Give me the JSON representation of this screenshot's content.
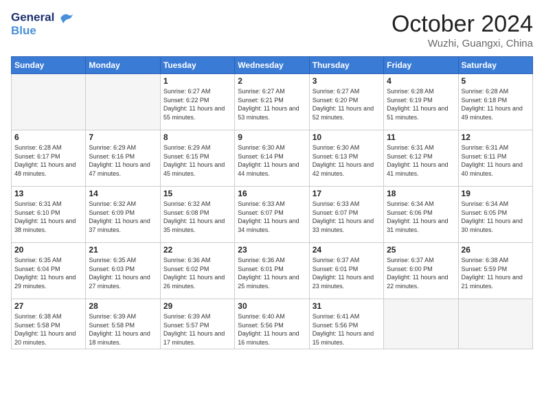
{
  "header": {
    "logo_line1": "General",
    "logo_line2": "Blue",
    "month": "October 2024",
    "location": "Wuzhi, Guangxi, China"
  },
  "weekdays": [
    "Sunday",
    "Monday",
    "Tuesday",
    "Wednesday",
    "Thursday",
    "Friday",
    "Saturday"
  ],
  "weeks": [
    [
      {
        "day": "",
        "info": ""
      },
      {
        "day": "",
        "info": ""
      },
      {
        "day": "1",
        "info": "Sunrise: 6:27 AM\nSunset: 6:22 PM\nDaylight: 11 hours and 55 minutes."
      },
      {
        "day": "2",
        "info": "Sunrise: 6:27 AM\nSunset: 6:21 PM\nDaylight: 11 hours and 53 minutes."
      },
      {
        "day": "3",
        "info": "Sunrise: 6:27 AM\nSunset: 6:20 PM\nDaylight: 11 hours and 52 minutes."
      },
      {
        "day": "4",
        "info": "Sunrise: 6:28 AM\nSunset: 6:19 PM\nDaylight: 11 hours and 51 minutes."
      },
      {
        "day": "5",
        "info": "Sunrise: 6:28 AM\nSunset: 6:18 PM\nDaylight: 11 hours and 49 minutes."
      }
    ],
    [
      {
        "day": "6",
        "info": "Sunrise: 6:28 AM\nSunset: 6:17 PM\nDaylight: 11 hours and 48 minutes."
      },
      {
        "day": "7",
        "info": "Sunrise: 6:29 AM\nSunset: 6:16 PM\nDaylight: 11 hours and 47 minutes."
      },
      {
        "day": "8",
        "info": "Sunrise: 6:29 AM\nSunset: 6:15 PM\nDaylight: 11 hours and 45 minutes."
      },
      {
        "day": "9",
        "info": "Sunrise: 6:30 AM\nSunset: 6:14 PM\nDaylight: 11 hours and 44 minutes."
      },
      {
        "day": "10",
        "info": "Sunrise: 6:30 AM\nSunset: 6:13 PM\nDaylight: 11 hours and 42 minutes."
      },
      {
        "day": "11",
        "info": "Sunrise: 6:31 AM\nSunset: 6:12 PM\nDaylight: 11 hours and 41 minutes."
      },
      {
        "day": "12",
        "info": "Sunrise: 6:31 AM\nSunset: 6:11 PM\nDaylight: 11 hours and 40 minutes."
      }
    ],
    [
      {
        "day": "13",
        "info": "Sunrise: 6:31 AM\nSunset: 6:10 PM\nDaylight: 11 hours and 38 minutes."
      },
      {
        "day": "14",
        "info": "Sunrise: 6:32 AM\nSunset: 6:09 PM\nDaylight: 11 hours and 37 minutes."
      },
      {
        "day": "15",
        "info": "Sunrise: 6:32 AM\nSunset: 6:08 PM\nDaylight: 11 hours and 35 minutes."
      },
      {
        "day": "16",
        "info": "Sunrise: 6:33 AM\nSunset: 6:07 PM\nDaylight: 11 hours and 34 minutes."
      },
      {
        "day": "17",
        "info": "Sunrise: 6:33 AM\nSunset: 6:07 PM\nDaylight: 11 hours and 33 minutes."
      },
      {
        "day": "18",
        "info": "Sunrise: 6:34 AM\nSunset: 6:06 PM\nDaylight: 11 hours and 31 minutes."
      },
      {
        "day": "19",
        "info": "Sunrise: 6:34 AM\nSunset: 6:05 PM\nDaylight: 11 hours and 30 minutes."
      }
    ],
    [
      {
        "day": "20",
        "info": "Sunrise: 6:35 AM\nSunset: 6:04 PM\nDaylight: 11 hours and 29 minutes."
      },
      {
        "day": "21",
        "info": "Sunrise: 6:35 AM\nSunset: 6:03 PM\nDaylight: 11 hours and 27 minutes."
      },
      {
        "day": "22",
        "info": "Sunrise: 6:36 AM\nSunset: 6:02 PM\nDaylight: 11 hours and 26 minutes."
      },
      {
        "day": "23",
        "info": "Sunrise: 6:36 AM\nSunset: 6:01 PM\nDaylight: 11 hours and 25 minutes."
      },
      {
        "day": "24",
        "info": "Sunrise: 6:37 AM\nSunset: 6:01 PM\nDaylight: 11 hours and 23 minutes."
      },
      {
        "day": "25",
        "info": "Sunrise: 6:37 AM\nSunset: 6:00 PM\nDaylight: 11 hours and 22 minutes."
      },
      {
        "day": "26",
        "info": "Sunrise: 6:38 AM\nSunset: 5:59 PM\nDaylight: 11 hours and 21 minutes."
      }
    ],
    [
      {
        "day": "27",
        "info": "Sunrise: 6:38 AM\nSunset: 5:58 PM\nDaylight: 11 hours and 20 minutes."
      },
      {
        "day": "28",
        "info": "Sunrise: 6:39 AM\nSunset: 5:58 PM\nDaylight: 11 hours and 18 minutes."
      },
      {
        "day": "29",
        "info": "Sunrise: 6:39 AM\nSunset: 5:57 PM\nDaylight: 11 hours and 17 minutes."
      },
      {
        "day": "30",
        "info": "Sunrise: 6:40 AM\nSunset: 5:56 PM\nDaylight: 11 hours and 16 minutes."
      },
      {
        "day": "31",
        "info": "Sunrise: 6:41 AM\nSunset: 5:56 PM\nDaylight: 11 hours and 15 minutes."
      },
      {
        "day": "",
        "info": ""
      },
      {
        "day": "",
        "info": ""
      }
    ]
  ]
}
